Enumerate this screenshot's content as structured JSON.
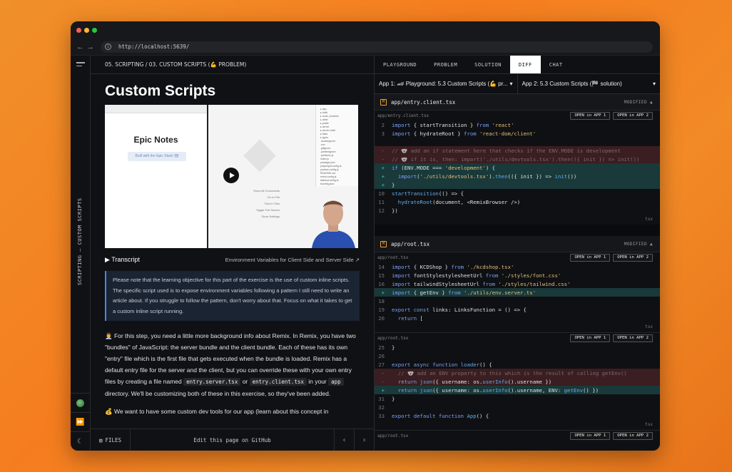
{
  "browser": {
    "url": "http://localhost:5639/",
    "back": "←",
    "forward": "→"
  },
  "breadcrumb": {
    "text": "05. SCRIPTING  /  03. CUSTOM SCRIPTS (💪 PROBLEM)"
  },
  "rail": {
    "vertical_label": "SCRIPTING — CUSTOM SCRIPTS",
    "theme_icon": "moon-icon",
    "expand_icon": "double-chevron-right-icon"
  },
  "page": {
    "title": "Custom Scripts",
    "video": {
      "epic_notes": "Epic Notes",
      "built_with": "Built with the Epic Stack 🏗",
      "commands": [
        "Show All Commands",
        "Go to File",
        "Find in Files",
        "Toggle Full Screen",
        "Show Settings"
      ]
    },
    "transcript_label": "▶  Transcript",
    "env_link": "Environment Variables for Client Side and Server Side ↗",
    "note": "Please note that the learning objective for this part of the exercise is the use of custom inline scripts. The specific script used is to expose environment variables following a pattern I still need to write an article about. If you struggle to follow the pattern, don't worry about that. Focus on what it takes to get a custom inline script running.",
    "para1_a": "👨‍💼 For this step, you need a little more background info about Remix. In Remix, you have two \"bundles\" of JavaScript: the server bundle and the client bundle. Each of these has its own \"entry\" file which is the first file that gets executed when the bundle is loaded. Remix has a default entry file for the server and the client, but you can override these with your own entry files by creating a file named ",
    "code1": "entry.server.tsx",
    "para1_b": " or ",
    "code2": "entry.client.tsx",
    "para1_c": " in your ",
    "code3": "app",
    "para1_d": " directory. We'll be customizing both of these in this exercise, so they've been added.",
    "para2": "💰 We want to have some custom dev tools for our app (learn about this concept in"
  },
  "footer": {
    "files": "FILES",
    "edit": "Edit this page on GitHub",
    "prev": "‹",
    "next": "›"
  },
  "tabs": [
    "PLAYGROUND",
    "PROBLEM",
    "SOLUTION",
    "DIFF",
    "CHAT"
  ],
  "active_tab": "DIFF",
  "apps": {
    "app1": "App 1: 🏎 Playground: 5.3 Custom Scripts (💪 pr...",
    "app2": "App 2: 5.3 Custom Scripts (🏁 solution)"
  },
  "diff": {
    "file1": {
      "name": "app/entry.client.tsx",
      "status": "MODIFIED",
      "path": "app/entry.client.tsx",
      "open1": "OPEN in APP 1",
      "open2": "OPEN in APP 2",
      "lang": "tsx"
    },
    "file2": {
      "name": "app/root.tsx",
      "status": "MODIFIED",
      "path": "app/root.tsx",
      "open1": "OPEN in APP 1",
      "open2": "OPEN in APP 2",
      "lang": "tsx",
      "path2": "app/root.tsx",
      "path3": "app/root.tsx"
    }
  },
  "colors": {
    "accent": "#4a86e8",
    "deleted_bg": "#3a1e22",
    "added_bg": "#19393a",
    "background": "#f57d1f"
  }
}
